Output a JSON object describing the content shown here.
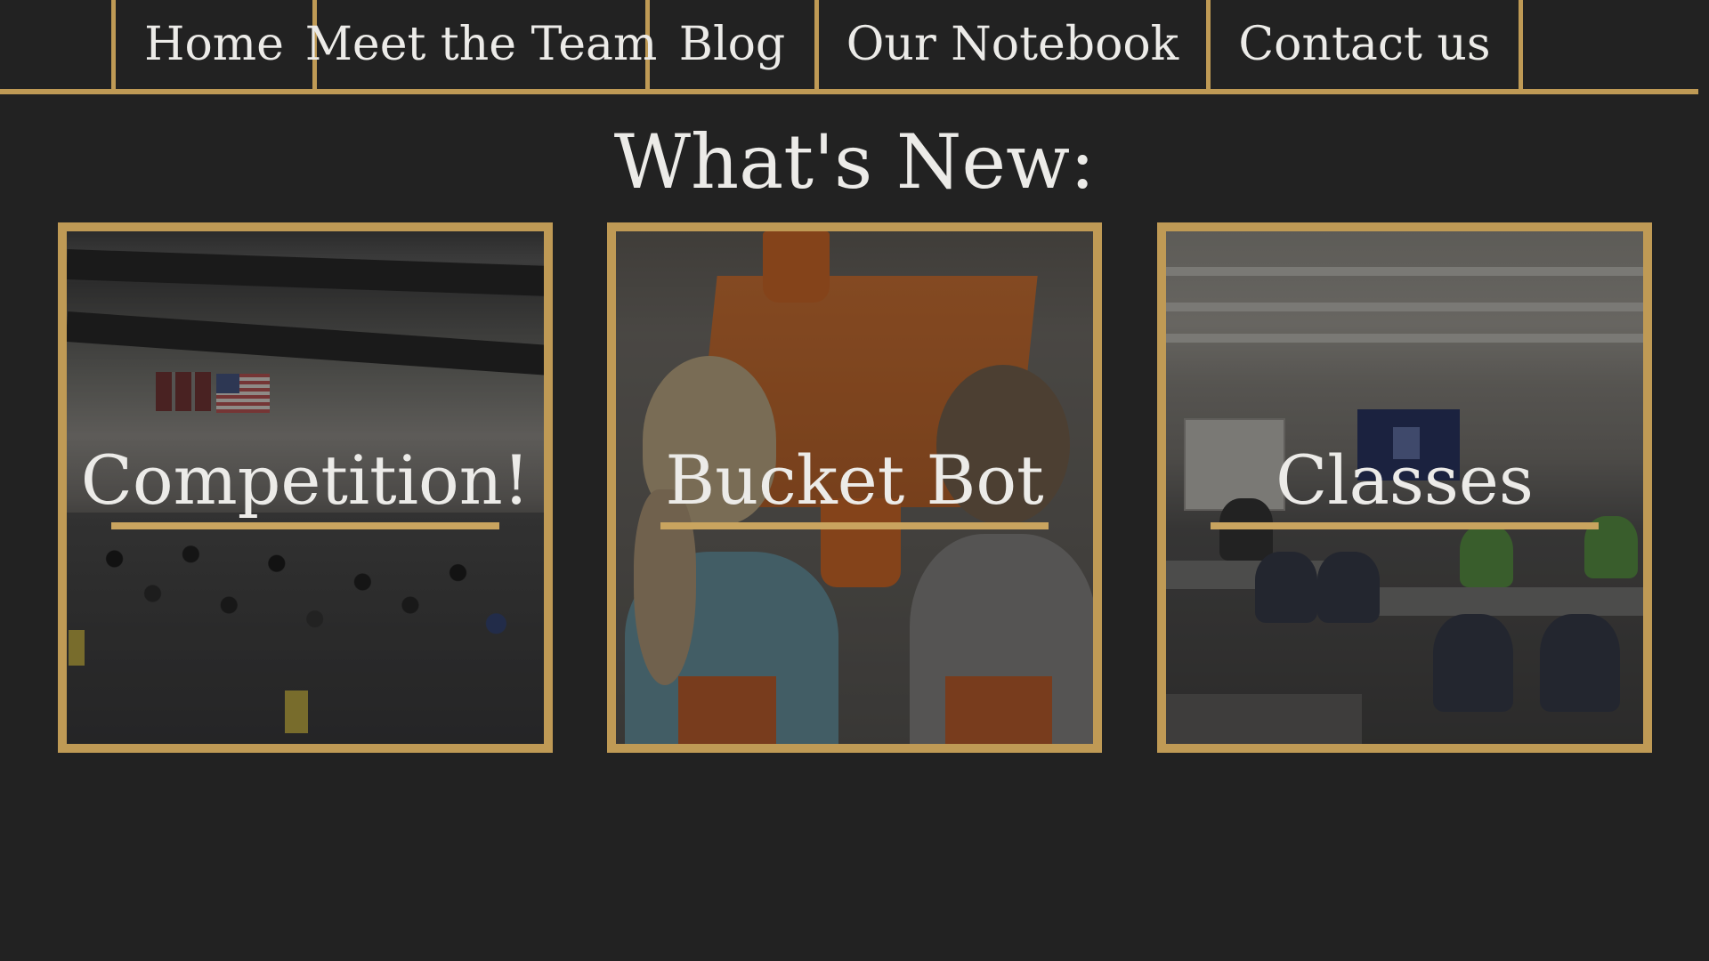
{
  "nav": {
    "items": [
      {
        "label": "Home"
      },
      {
        "label": "Meet the Team"
      },
      {
        "label": "Blog"
      },
      {
        "label": "Our Notebook"
      },
      {
        "label": "Contact us"
      }
    ]
  },
  "page": {
    "title": "What's New:"
  },
  "cards": [
    {
      "label": "Competition!",
      "image": "gym-competition-photo"
    },
    {
      "label": "Bucket Bot",
      "image": "bucket-bot-kids-photo"
    },
    {
      "label": "Classes",
      "image": "classroom-photo"
    }
  ],
  "colors": {
    "background": "#222222",
    "accent_gold": "#bf9a55",
    "text": "#ecebe8"
  }
}
